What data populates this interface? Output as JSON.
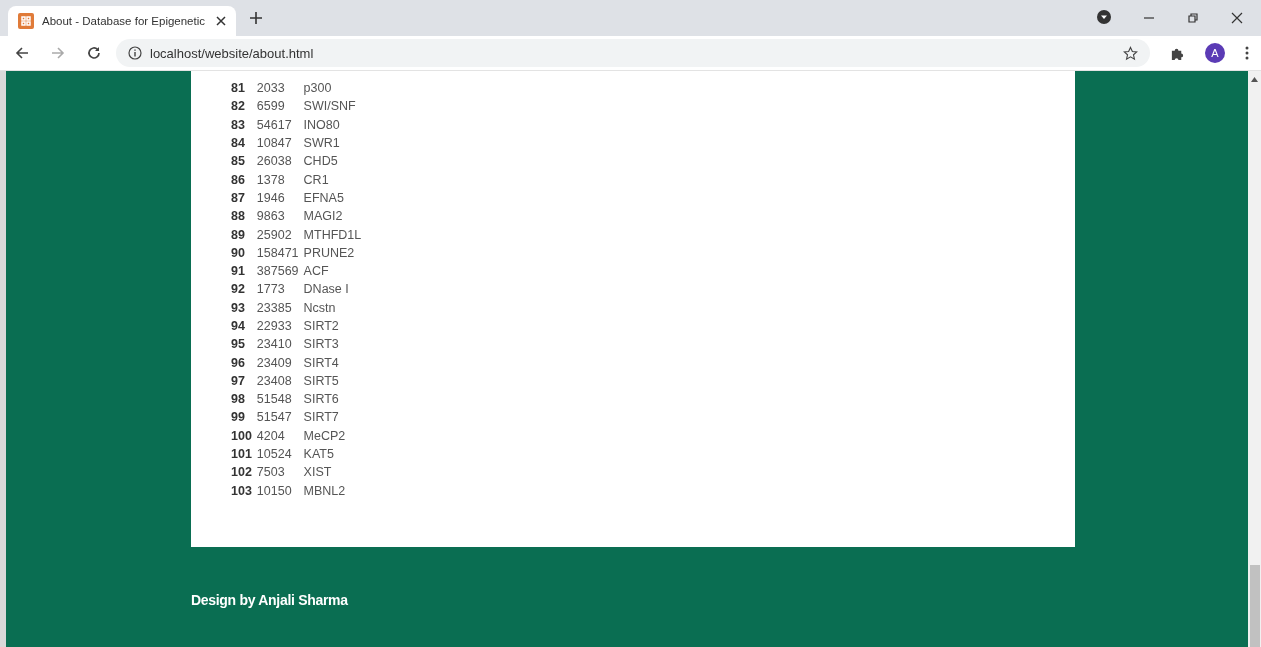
{
  "browser": {
    "tab": {
      "title": "About - Database for Epigenetic",
      "selected": true
    },
    "address": "localhost/website/about.html",
    "profile_initial": "A"
  },
  "table": {
    "rows": [
      {
        "index": "81",
        "gene_id": "2033",
        "name": "p300"
      },
      {
        "index": "82",
        "gene_id": "6599",
        "name": "SWI/SNF"
      },
      {
        "index": "83",
        "gene_id": "54617",
        "name": "INO80"
      },
      {
        "index": "84",
        "gene_id": "10847",
        "name": "SWR1"
      },
      {
        "index": "85",
        "gene_id": "26038",
        "name": "CHD5"
      },
      {
        "index": "86",
        "gene_id": "1378",
        "name": "CR1"
      },
      {
        "index": "87",
        "gene_id": "1946",
        "name": "EFNA5"
      },
      {
        "index": "88",
        "gene_id": "9863",
        "name": "MAGI2"
      },
      {
        "index": "89",
        "gene_id": "25902",
        "name": "MTHFD1L"
      },
      {
        "index": "90",
        "gene_id": "158471",
        "name": "PRUNE2"
      },
      {
        "index": "91",
        "gene_id": "387569",
        "name": "ACF"
      },
      {
        "index": "92",
        "gene_id": "1773",
        "name": "DNase I"
      },
      {
        "index": "93",
        "gene_id": "23385",
        "name": "Ncstn"
      },
      {
        "index": "94",
        "gene_id": "22933",
        "name": "SIRT2"
      },
      {
        "index": "95",
        "gene_id": "23410",
        "name": "SIRT3"
      },
      {
        "index": "96",
        "gene_id": "23409",
        "name": "SIRT4"
      },
      {
        "index": "97",
        "gene_id": "23408",
        "name": "SIRT5"
      },
      {
        "index": "98",
        "gene_id": "51548",
        "name": "SIRT6"
      },
      {
        "index": "99",
        "gene_id": "51547",
        "name": "SIRT7"
      },
      {
        "index": "100",
        "gene_id": "4204",
        "name": "MeCP2"
      },
      {
        "index": "101",
        "gene_id": "10524",
        "name": "KAT5"
      },
      {
        "index": "102",
        "gene_id": "7503",
        "name": "XIST"
      },
      {
        "index": "103",
        "gene_id": "10150",
        "name": "MBNL2"
      }
    ]
  },
  "footer": {
    "credit": "Design by Anjali Sharma"
  }
}
